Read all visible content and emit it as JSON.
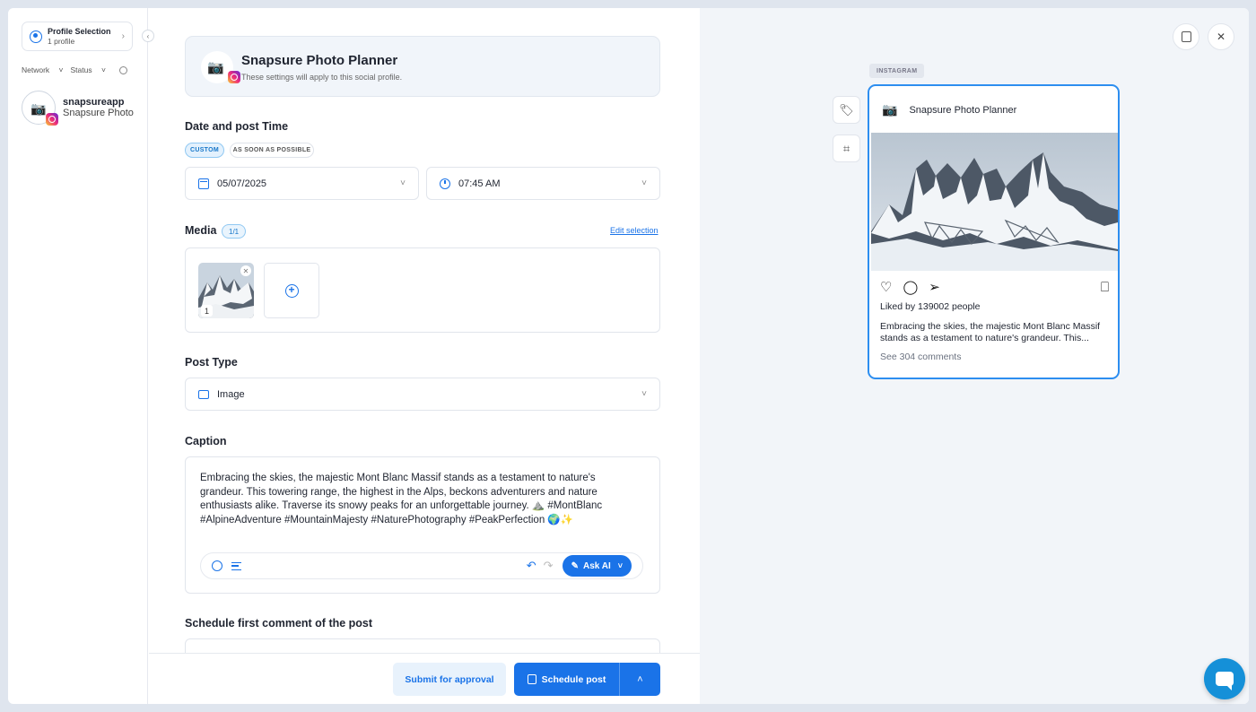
{
  "sidebar": {
    "profile_selection": {
      "title": "Profile Selection",
      "subtitle": "1 profile"
    },
    "filters": {
      "network": "Network",
      "status": "Status"
    },
    "account": {
      "handle": "snapsureapp",
      "name": "Snapsure Photo Planner"
    }
  },
  "header": {
    "title": "Snapsure Photo Planner",
    "subtitle": "These settings will apply to this social profile."
  },
  "schedule": {
    "label": "Date and post Time",
    "chips": [
      "CUSTOM",
      "AS SOON AS POSSIBLE"
    ],
    "active_chip": "CUSTOM",
    "date": "05/07/2025",
    "time": "07:45 AM"
  },
  "media": {
    "label": "Media",
    "count": "1/1",
    "edit_link": "Edit selection",
    "items": [
      {
        "index": "1"
      }
    ]
  },
  "post_type": {
    "label": "Post Type",
    "value": "Image"
  },
  "caption": {
    "label": "Caption",
    "text": "Embracing the skies, the majestic Mont Blanc Massif stands as a testament to nature's grandeur. This towering range, the highest in the Alps, beckons adventurers and nature enthusiasts alike. Traverse its snowy peaks for an unforgettable journey. ⛰️ #MontBlanc #AlpineAdventure #MountainMajesty #NaturePhotography #PeakPerfection 🌍✨",
    "ask_ai_label": "Ask AI"
  },
  "first_comment": {
    "label": "Schedule first comment of the post"
  },
  "footer": {
    "approval_label": "Submit for approval",
    "schedule_label": "Schedule post"
  },
  "preview": {
    "network_tag": "INSTAGRAM",
    "profile_name": "Snapsure Photo Planner",
    "likes": "Liked by 139002 people",
    "caption": "Embracing the skies, the majestic Mont Blanc Massif stands as a testament to nature's grandeur. This...",
    "comments": "See 304 comments"
  },
  "icons": {
    "profile": "user-circle-icon",
    "calendar": "calendar-icon",
    "clock": "clock-icon",
    "image_type": "image-icon",
    "emoji": "emoji-icon",
    "text_format": "text-format-icon",
    "undo": "undo-icon",
    "redo": "redo-icon",
    "tag": "tag-icon",
    "crop": "crop-icon",
    "notes": "notes-icon",
    "close": "close-icon",
    "chat": "chat-icon"
  },
  "colors": {
    "accent": "#1a73e8",
    "preview_border": "#2d8ef0",
    "chat": "#1590d8"
  }
}
